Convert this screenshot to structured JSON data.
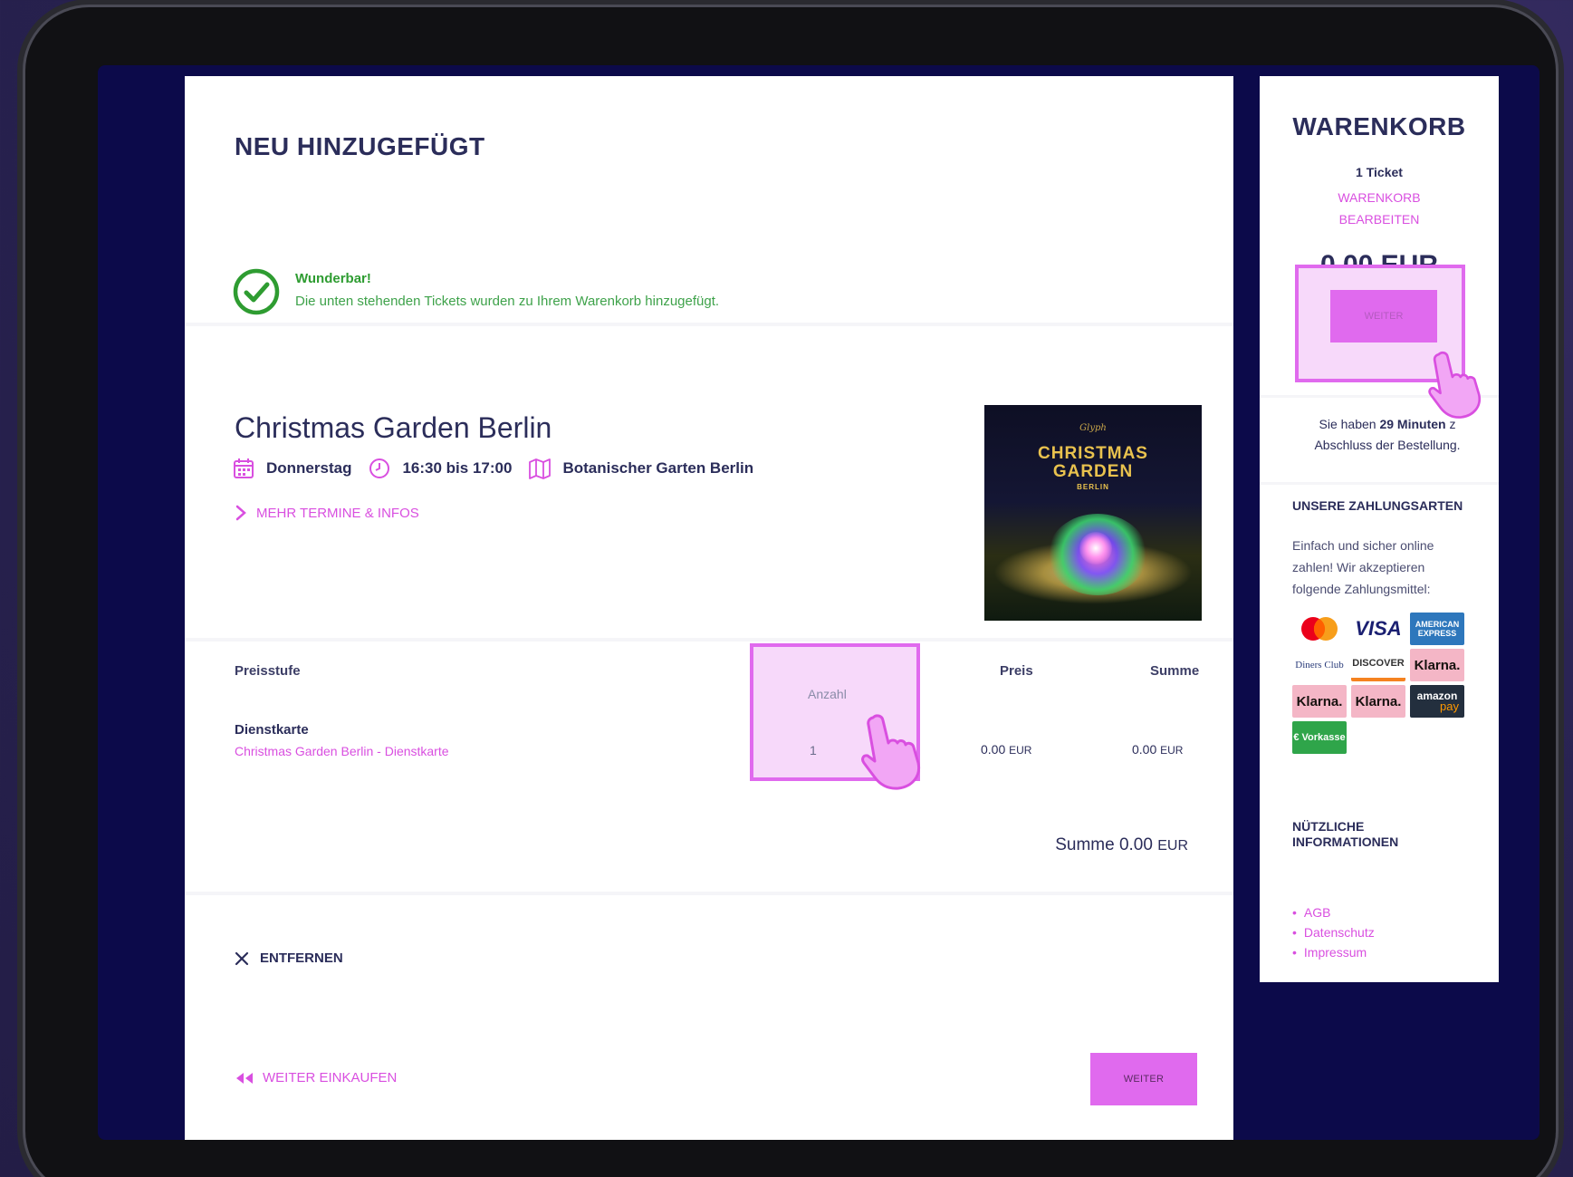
{
  "main": {
    "title": "NEU HINZUGEFÜGT",
    "success": {
      "heading": "Wunderbar!",
      "message": "Die unten stehenden Tickets wurden zu Ihrem Warenkorb hinzugefügt."
    },
    "event": {
      "name": "Christmas Garden Berlin",
      "day": "Donnerstag",
      "time": "16:30 bis 17:00",
      "location": "Botanischer Garten Berlin",
      "more_link": "MEHR TERMINE & INFOS",
      "image": {
        "small": "Glyph",
        "title_line1": "CHRISTMAS",
        "title_line2": "GARDEN",
        "subtitle": "BERLIN"
      }
    },
    "table": {
      "headers": {
        "tier": "Preisstufe",
        "qty": "Anzahl",
        "price": "Preis",
        "sum": "Summe"
      },
      "row": {
        "tier": "Dienstkarte",
        "tier_sub": "Christmas Garden  Berlin - Dienstkarte",
        "qty": "1",
        "price": "0.00",
        "sum": "0.00",
        "currency": "EUR"
      },
      "total_label": "Summe 0.00",
      "total_currency": "EUR"
    },
    "remove_label": "ENTFERNEN",
    "back_label": "WEITER EINKAUFEN",
    "continue_label": "WEITER"
  },
  "sidebar": {
    "title": "WARENKORB",
    "count": "1 Ticket",
    "edit_line1": "WARENKORB",
    "edit_line2": "BEARBEITEN",
    "amount": "0.00 EUR",
    "continue_label": "WEITER",
    "time_pre": "Sie haben ",
    "time_bold": "29 Minuten",
    "time_post": " z",
    "time_line2": "Abschluss der Bestellung.",
    "payments_heading": "UNSERE ZAHLUNGSARTEN",
    "payments_desc": "Einfach und sicher online zahlen! Wir akzeptieren folgende Zahlungsmittel:",
    "payment_methods": [
      {
        "name": "mastercard",
        "label": ""
      },
      {
        "name": "visa",
        "label": "VISA"
      },
      {
        "name": "amex",
        "label": "AMERICAN EXPRESS"
      },
      {
        "name": "diners",
        "label": "Diners Club"
      },
      {
        "name": "discover",
        "label": "DISCOVER"
      },
      {
        "name": "klarna",
        "label": "Klarna."
      },
      {
        "name": "klarna",
        "label": "Klarna."
      },
      {
        "name": "klarna",
        "label": "Klarna."
      },
      {
        "name": "amazon-pay",
        "label": "amazon",
        "sub": "pay"
      },
      {
        "name": "vorkasse",
        "label": "€ Vorkasse"
      }
    ],
    "info_heading_line1": "NÜTZLICHE",
    "info_heading_line2": "INFORMATIONEN",
    "info_links": [
      "AGB",
      "Datenschutz",
      "Impressum"
    ]
  },
  "colors": {
    "accent": "#e06aee",
    "link": "#d94fe0",
    "success": "#2e9c31",
    "navy": "#2b2d5a"
  }
}
